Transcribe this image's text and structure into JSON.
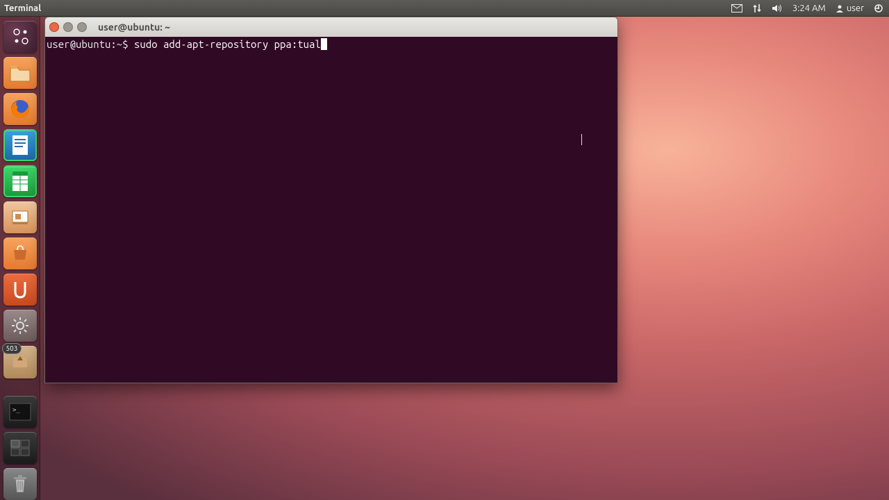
{
  "panel": {
    "app_name": "Terminal",
    "time": "3:24 AM",
    "user": "user",
    "icons": {
      "mail": "mail-icon",
      "network": "network-icon",
      "sound": "sound-icon",
      "user": "user-icon",
      "power": "power-icon"
    }
  },
  "launcher": {
    "items": [
      {
        "name": "dash",
        "label": "Dash"
      },
      {
        "name": "files",
        "label": "Files"
      },
      {
        "name": "firefox",
        "label": "Firefox"
      },
      {
        "name": "writer",
        "label": "LibreOffice Writer"
      },
      {
        "name": "calc",
        "label": "LibreOffice Calc"
      },
      {
        "name": "impress",
        "label": "LibreOffice Impress"
      },
      {
        "name": "software-center",
        "label": "Software Center"
      },
      {
        "name": "ubuntu-one",
        "label": "Ubuntu One"
      },
      {
        "name": "settings",
        "label": "System Settings"
      },
      {
        "name": "update-manager",
        "label": "Update Manager",
        "badge": "503"
      },
      {
        "name": "terminal",
        "label": "Terminal"
      },
      {
        "name": "workspace-switcher",
        "label": "Workspace Switcher"
      },
      {
        "name": "trash",
        "label": "Trash"
      }
    ]
  },
  "window": {
    "title": "user@ubuntu: ~",
    "prompt": "user@ubuntu:~$ ",
    "command": "sudo add-apt-repository ppa:tual"
  }
}
